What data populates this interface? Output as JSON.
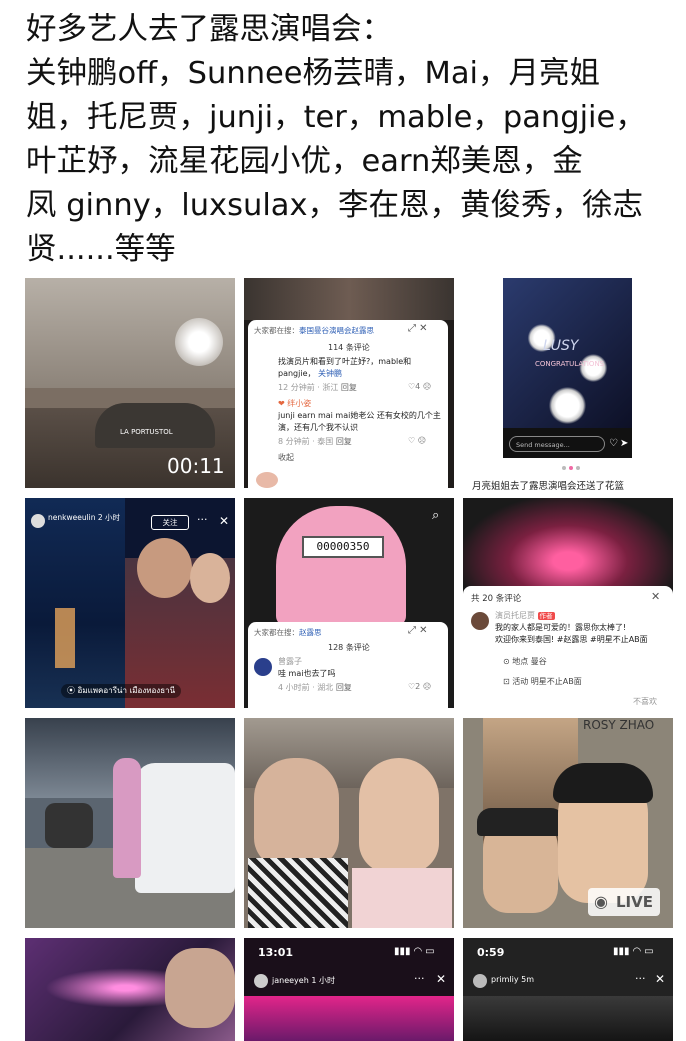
{
  "post": {
    "lines": [
      "好多艺人去了露思演唱会：",
      "关钟鹏off，Sunnee杨芸晴，Mai，月亮姐",
      "姐，托尼贾，junji，ter，mable，pangjie，",
      "叶芷妤，流星花园小优，earn郑美恩，金",
      "凤 ginny，luxsulax，李在恩，黄俊秀，徐志",
      "贤......等等"
    ]
  },
  "tiles": {
    "t1": {
      "duration": "00:11",
      "sign_text": "LA PORTUSTOL"
    },
    "t2": {
      "header": "大家都在搜：",
      "header_link": "泰国曼谷演唱会赵露思",
      "count": "114 条评论",
      "c1_text": "找演员片和看到了叶芷妤?，mable和",
      "c1_text2": "pangjie，",
      "c1_link": "关钟鹏",
      "c1_meta": "12 分钟前 · 浙江",
      "c1_reply": "回复",
      "c1_likes": "4",
      "c2_user": "❤ 绊小姿",
      "c2_text": "junji earn mai mai她老公 还有女校的几个主",
      "c2_text2": "演，还有几个我不认识",
      "c2_meta": "8 分钟前 · 泰国",
      "c2_reply": "回复",
      "collapse": "收起"
    },
    "t3": {
      "logo": "LUSY",
      "banner": "CONGRATULATIONS",
      "message_placeholder": "Send message...",
      "caption": "月亮姐姐去了露思演唱会还送了花篮"
    },
    "t4": {
      "username": "nenkweeulin",
      "time": "2 小时",
      "follow": "关注",
      "location": "อิมแพคอารีน่า เมืองทองธานี"
    },
    "t5": {
      "counter": "00000350",
      "header": "大家都在搜：",
      "header_link": "赵露思",
      "count": "128 条评论",
      "c1_user": "曾露子",
      "c1_text": "哇 mai也去了吗",
      "c1_meta": "4 小时前 · 湖北",
      "c1_reply": "回复",
      "c1_likes": "2"
    },
    "t6": {
      "count": "共 20 条评论",
      "user": "演员托尼贾",
      "badge": "作者",
      "text": "我的家人都是可爱的！露思你太棒了!",
      "text2": "欢迎你来到泰国! #赵露思 #明星不止AB面",
      "loc": "地点 曼谷",
      "activity": "活动 明星不止AB面",
      "more": "不喜欢"
    },
    "t7": {},
    "t8": {},
    "t9": {
      "poster_text": "ROSY ZHAO",
      "live": "LIVE"
    },
    "t10": {},
    "t11": {
      "time": "13:01",
      "username": "janeeyeh",
      "ago": "1 小时"
    },
    "t12": {
      "time": "0:59",
      "username": "primliy",
      "ago": "5m"
    }
  },
  "colors": {
    "pink": "#f06aa5",
    "link": "#2e5fb5",
    "badge": "#f04a4a"
  }
}
